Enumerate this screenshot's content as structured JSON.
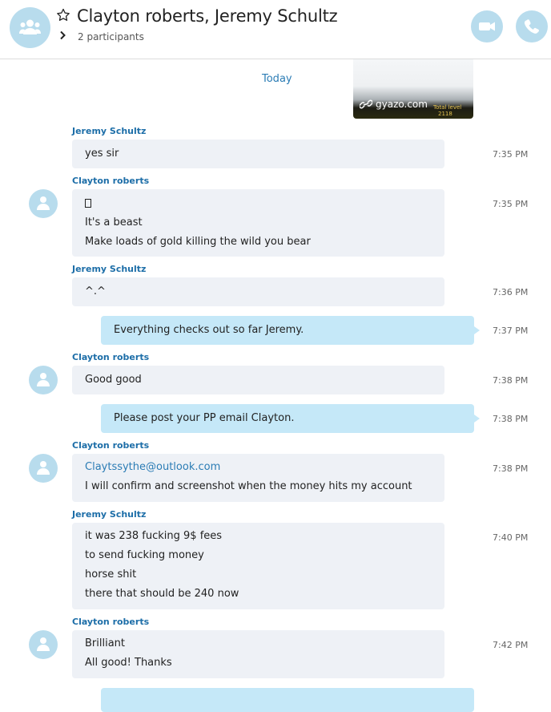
{
  "header": {
    "title": "Clayton roberts, Jeremy Schultz",
    "participants": "2 participants"
  },
  "image_preview": {
    "source": "gyazo.com",
    "overlay_text": "Total level",
    "overlay_value": "2118"
  },
  "conversation": {
    "date_divider": "Today",
    "messages": [
      {
        "sender": "Jeremy Schultz",
        "lines": [
          "yes sir"
        ],
        "time": "7:35 PM"
      },
      {
        "sender": "Clayton roberts",
        "lines": [
          "",
          "It's a beast",
          "Make loads of gold killing the wild you bear"
        ],
        "time": "7:35 PM"
      },
      {
        "sender": "Jeremy Schultz",
        "lines": [
          "^.^"
        ],
        "time": "7:36 PM"
      },
      {
        "sender": "me",
        "lines": [
          "Everything checks out so far Jeremy."
        ],
        "time": "7:37 PM"
      },
      {
        "sender": "Clayton roberts",
        "lines": [
          "Good good"
        ],
        "time": "7:38 PM"
      },
      {
        "sender": "me",
        "lines": [
          "Please post your PP email Clayton."
        ],
        "time": "7:38 PM"
      },
      {
        "sender": "Clayton roberts",
        "lines": [
          "Claytssythe@outlook.com",
          "I will confirm and screenshot when the money hits my account"
        ],
        "time": "7:38 PM"
      },
      {
        "sender": "Jeremy Schultz",
        "lines": [
          "it was 238 fucking 9$ fees",
          "to send fucking money",
          "horse shit",
          "there that should be 240 now"
        ],
        "time": "7:40 PM"
      },
      {
        "sender": "Clayton roberts",
        "lines": [
          "Brilliant",
          "All good! Thanks"
        ],
        "time": "7:42 PM"
      }
    ]
  },
  "colors": {
    "accent": "#1d6ea8",
    "link": "#2b7cb5",
    "incoming_bubble": "#eef1f6",
    "outgoing_bubble": "#c5e8f8",
    "avatar_bg": "#b8dced"
  },
  "icons": [
    "group-icon",
    "star-icon",
    "chevron-right-icon",
    "video-call-icon",
    "audio-call-icon",
    "user-icon",
    "gyazo-link-icon"
  ]
}
